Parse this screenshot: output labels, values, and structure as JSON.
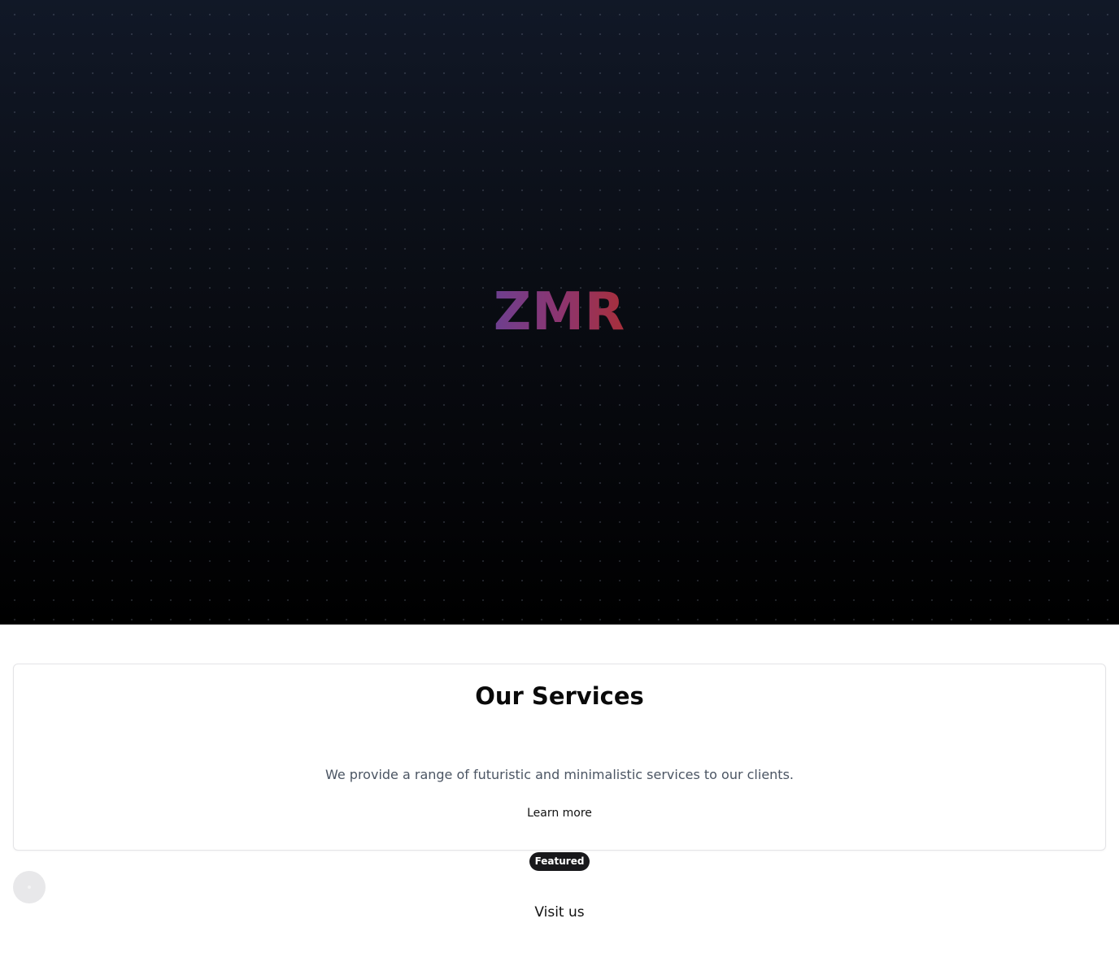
{
  "hero": {
    "logo_text": "ZMR",
    "gradient_colors": [
      "#6d3f8f",
      "#8c3570",
      "#a72f3a"
    ],
    "background_top": "#111827",
    "background_bottom": "#000000"
  },
  "services": {
    "title": "Our Services",
    "description": "We provide a range of futuristic and minimalistic services to our clients.",
    "link_label": "Learn more"
  },
  "badge": {
    "label": "Featured"
  },
  "footer": {
    "visit_label": "Visit us"
  },
  "floating_button": {
    "icon": "dot-icon"
  }
}
